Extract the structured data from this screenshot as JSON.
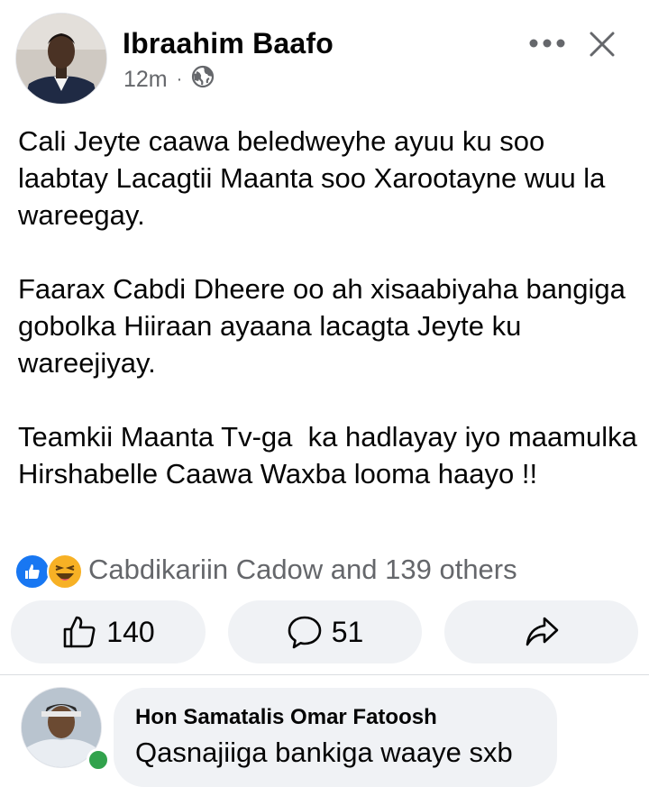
{
  "post": {
    "author": "Ibraahim Baafo",
    "time": "12m",
    "separator": "·",
    "privacy_icon": "globe-icon",
    "text": "Cali Jeyte caawa beledweyhe ayuu ku soo laabtay Lacagtii Maanta soo Xarootayne wuu la wareegay.\n\nFaarax Cabdi Dheere oo ah xisaabiyaha bangiga gobolka Hiiraan ayaana lacagta Jeyte ku wareejiyay.\n\nTeamkii Maanta Tv-ga  ka hadlayay iyo maamulka Hirshabelle Caawa Waxba looma haayo !!"
  },
  "reactions": {
    "icons": [
      "like-icon",
      "haha-icon"
    ],
    "summary": "Cabdikariin Cadow and 139 others"
  },
  "actions": {
    "like_count": "140",
    "comment_count": "51"
  },
  "comment": {
    "author": "Hon Samatalis Omar Fatoosh",
    "text": "Qasnajiiga bankiga waaye sxb"
  },
  "colors": {
    "accent": "#1877f2",
    "muted_text": "#65676b",
    "button_bg": "#f0f2f5",
    "online": "#31a24c",
    "haha": "#f7b125"
  }
}
